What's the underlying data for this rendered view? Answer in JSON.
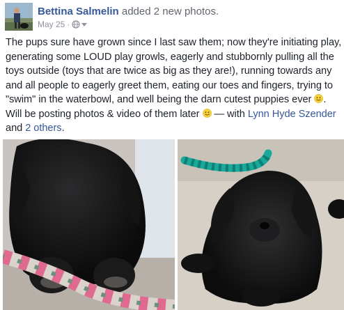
{
  "post": {
    "author": "Bettina Salmelin",
    "action": "added 2 new photos.",
    "date": "May 25",
    "separator": "·",
    "privacy_icon": "globe-icon",
    "privacy_menu_icon": "caret-down-icon",
    "text_main": "The pups sure have grown since I last saw them; now they're initiating play, generating some LOUD play growls, eagerly and stubbornly pulling all the toys outside (toys that are twice as big as they are!), running towards any and all people to eagerly greet them, eating our toes and fingers, trying to \"swim\" in the waterbowl, and well being the darn cutest puppies ever",
    "text_after_emoji1": ". Will be posting photos & video of them later",
    "text_with": " — with ",
    "tagged_user": "Lynn Hyde Szender",
    "text_and": " and ",
    "others_link": "2 others",
    "text_end": ".",
    "emoji": "smile-emoji"
  },
  "photos": [
    {
      "name": "photo-puppy-lying-with-rope-toy"
    },
    {
      "name": "photo-puppy-resting-on-sand"
    }
  ]
}
